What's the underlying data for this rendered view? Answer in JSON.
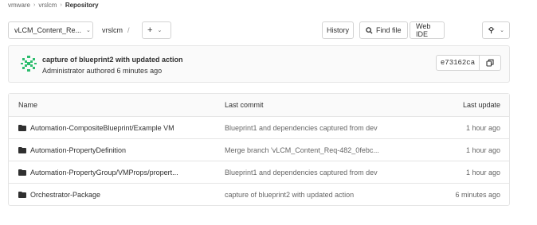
{
  "breadcrumb": {
    "items": [
      "vmware",
      "vrslcm",
      "Repository"
    ]
  },
  "toolbar": {
    "branch": "vLCM_Content_Re...",
    "path": "vrslcm",
    "path_separator": "/",
    "add_label": "+",
    "history": "History",
    "find_file": "Find file",
    "web_ide": "Web IDE"
  },
  "last_commit": {
    "title": "capture of blueprint2 with updated action",
    "meta": "Administrator authored 6 minutes ago",
    "sha": "e73162ca"
  },
  "tree": {
    "headers": {
      "name": "Name",
      "last_commit": "Last commit",
      "last_update": "Last update"
    },
    "rows": [
      {
        "name": "Automation-CompositeBlueprint/Example VM",
        "commit": "Blueprint1 and dependencies captured from dev",
        "updated": "1 hour ago"
      },
      {
        "name": "Automation-PropertyDefinition",
        "commit": "Merge branch 'vLCM_Content_Req-482_0febc...",
        "updated": "1 hour ago"
      },
      {
        "name": "Automation-PropertyGroup/VMProps/propert...",
        "commit": "Blueprint1 and dependencies captured from dev",
        "updated": "1 hour ago"
      },
      {
        "name": "Orchestrator-Package",
        "commit": "capture of blueprint2 with updated action",
        "updated": "6 minutes ago"
      }
    ]
  },
  "colors": {
    "border": "#e5e5e5",
    "avatar_green": "#2dbd6e"
  }
}
